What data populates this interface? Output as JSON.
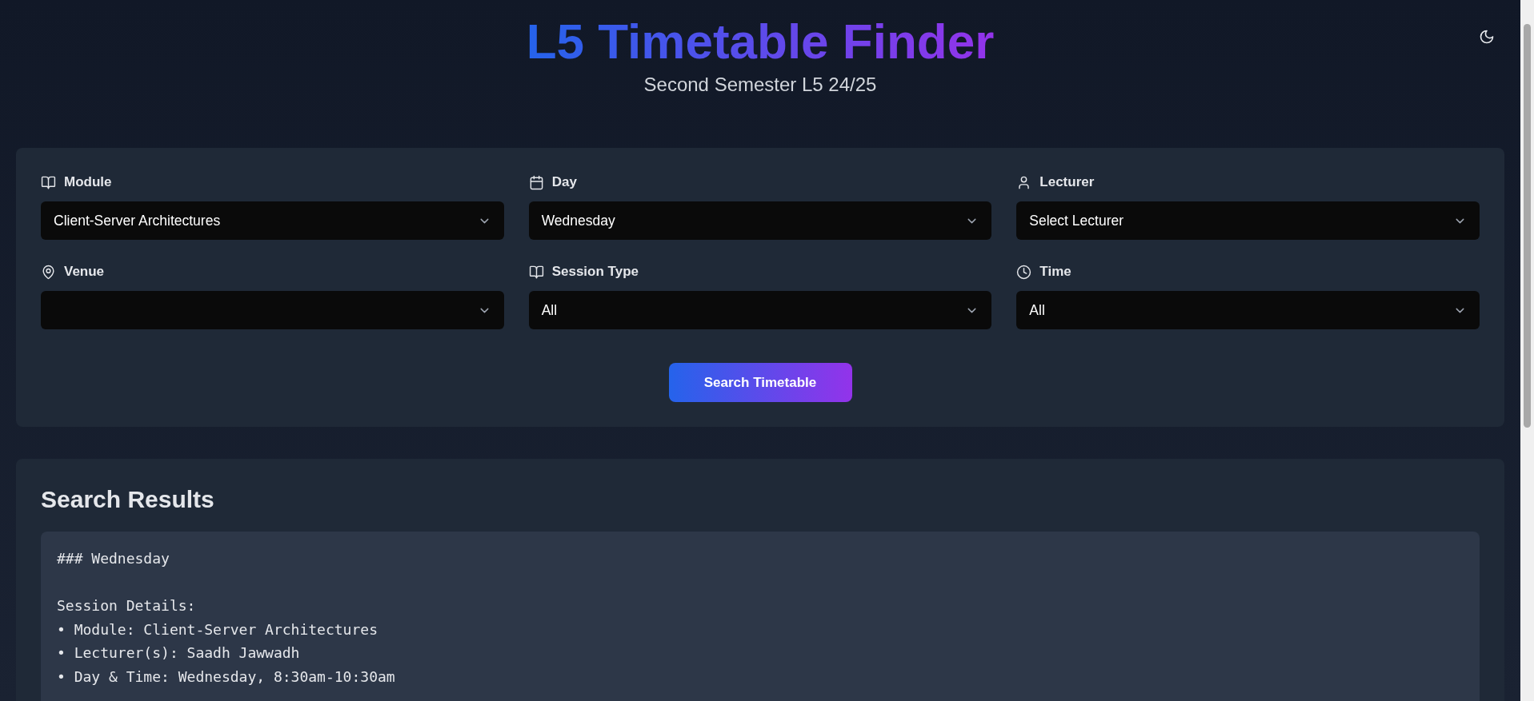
{
  "header": {
    "title": "L5 Timetable Finder",
    "subtitle": "Second Semester L5 24/25"
  },
  "filters": [
    {
      "label": "Module",
      "value": "Client-Server Architectures"
    },
    {
      "label": "Day",
      "value": "Wednesday"
    },
    {
      "label": "Lecturer",
      "value": "Select Lecturer"
    },
    {
      "label": "Venue"
    },
    {
      "label": "Session Type",
      "value": "All"
    },
    {
      "label": "Time",
      "value": "All"
    }
  ],
  "search_button": "Search Timetable",
  "results": {
    "title": "Search Results",
    "heading": "### Wednesday",
    "details_label": "Session Details:",
    "details": [
      "• Module: Client-Server Architectures",
      "• Lecturer(s): Saadh Jawwadh",
      "• Day & Time: Wednesday, 8:30am-10:30am"
    ]
  }
}
